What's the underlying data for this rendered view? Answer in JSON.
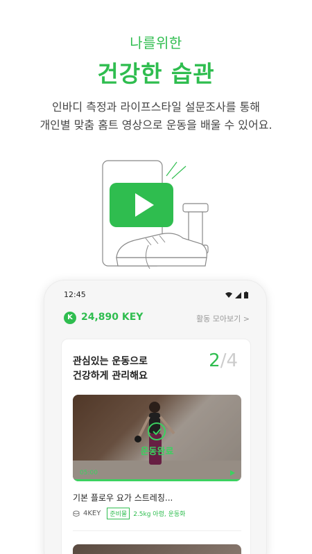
{
  "promo": {
    "subtitle": "나를위한",
    "title": "건강한 습관",
    "description_line1": "인바디 측정과 라이프스타일 설문조사를 통해",
    "description_line2": "개인별 맞춤 홈트 영상으로 운동을 배울 수 있어요."
  },
  "status_bar": {
    "time": "12:45",
    "icons": [
      "wifi-icon",
      "signal-icon",
      "battery-icon"
    ]
  },
  "key_summary": {
    "badge": "K",
    "value": "24,890 KEY",
    "activity_link": "활동 모아보기 >"
  },
  "card": {
    "title_line1": "관심있는 운동으로",
    "title_line2": "건강하게 관리해요",
    "progress_current": "2",
    "progress_total": "/4",
    "video": {
      "done_label": "운동완료",
      "duration": "05:00",
      "progress_fraction": 1.0,
      "title": "기본 플로우 요가 스트레칭...",
      "key_cost": "4KEY",
      "prep_tag": "준비물",
      "prep_items": "2.5kg 아령, 운동화"
    }
  },
  "colors": {
    "accent": "#2fbd4f",
    "text": "#333333",
    "muted": "#999999"
  }
}
